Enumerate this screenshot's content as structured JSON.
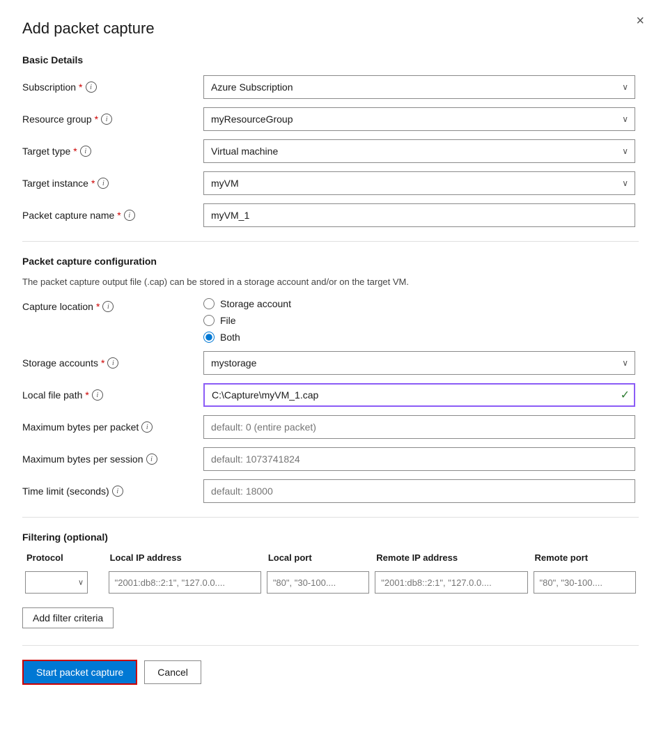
{
  "dialog": {
    "title": "Add packet capture",
    "close_label": "×"
  },
  "sections": {
    "basic_details": {
      "label": "Basic Details"
    },
    "packet_capture_config": {
      "label": "Packet capture configuration"
    },
    "filtering": {
      "label": "Filtering (optional)"
    }
  },
  "fields": {
    "subscription": {
      "label": "Subscription",
      "value": "Azure Subscription"
    },
    "resource_group": {
      "label": "Resource group",
      "value": "myResourceGroup"
    },
    "target_type": {
      "label": "Target type",
      "value": "Virtual machine"
    },
    "target_instance": {
      "label": "Target instance",
      "value": "myVM"
    },
    "packet_capture_name": {
      "label": "Packet capture name",
      "value": "myVM_1"
    },
    "config_note": "The packet capture output file (.cap) can be stored in a storage account and/or on the target VM.",
    "capture_location": {
      "label": "Capture location",
      "options": [
        {
          "id": "storage",
          "label": "Storage account",
          "checked": false
        },
        {
          "id": "file",
          "label": "File",
          "checked": false
        },
        {
          "id": "both",
          "label": "Both",
          "checked": true
        }
      ]
    },
    "storage_accounts": {
      "label": "Storage accounts",
      "value": "mystorage"
    },
    "local_file_path": {
      "label": "Local file path",
      "value": "C:\\Capture\\myVM_1.cap"
    },
    "max_bytes_per_packet": {
      "label": "Maximum bytes per packet",
      "placeholder": "default: 0 (entire packet)"
    },
    "max_bytes_per_session": {
      "label": "Maximum bytes per session",
      "placeholder": "default: 1073741824"
    },
    "time_limit": {
      "label": "Time limit (seconds)",
      "placeholder": "default: 18000"
    }
  },
  "filter_table": {
    "headers": [
      "Protocol",
      "Local IP address",
      "Local port",
      "Remote IP address",
      "Remote port"
    ],
    "row": {
      "protocol_placeholder": "",
      "local_ip_placeholder": "\"2001:db8::2:1\", \"127.0.0....",
      "local_port_placeholder": "\"80\", \"30-100....",
      "remote_ip_placeholder": "\"2001:db8::2:1\", \"127.0.0....",
      "remote_port_placeholder": "\"80\", \"30-100...."
    }
  },
  "buttons": {
    "add_filter": "Add filter criteria",
    "start_capture": "Start packet capture",
    "cancel": "Cancel"
  },
  "icons": {
    "info": "i",
    "chevron_down": "∨",
    "checkmark": "✓"
  }
}
